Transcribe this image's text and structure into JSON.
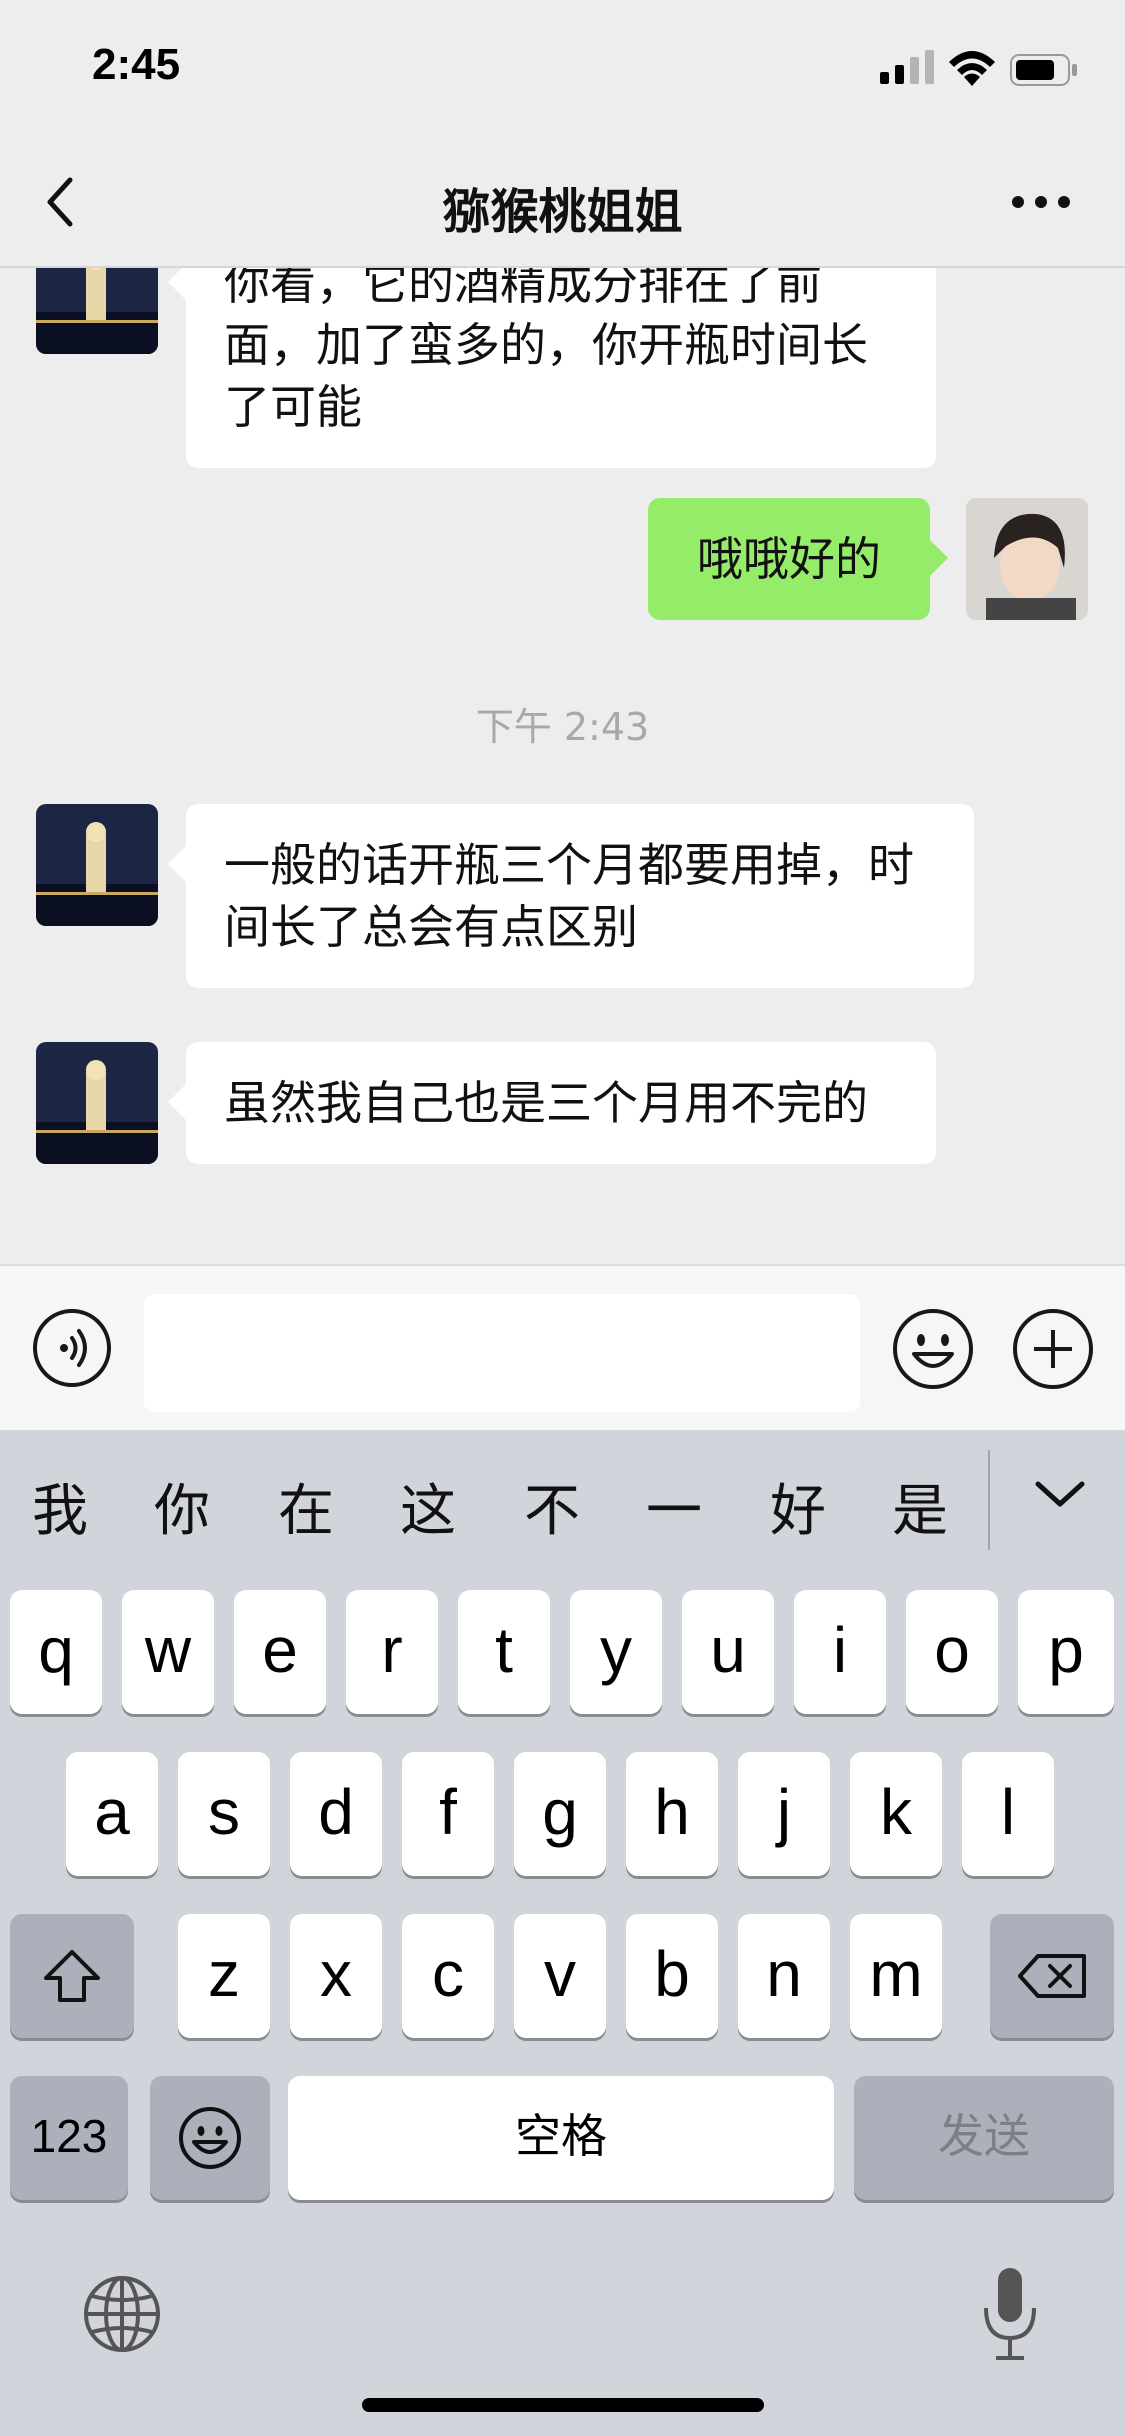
{
  "status": {
    "time": "2:45"
  },
  "nav": {
    "title": "猕猴桃姐姐"
  },
  "messages": [
    {
      "side": "left",
      "text": "你看，它的酒精成分排在了前面，加了蛮多的，你开瓶时间长了可能"
    },
    {
      "side": "right",
      "text": "哦哦好的"
    },
    {
      "type": "timestamp",
      "text": "下午 2:43"
    },
    {
      "side": "left",
      "text": "一般的话开瓶三个月都要用掉，时间长了总会有点区别"
    },
    {
      "side": "left",
      "text": "虽然我自己也是三个月用不完的"
    }
  ],
  "input": {
    "value": ""
  },
  "keyboard": {
    "candidates": [
      "我",
      "你",
      "在",
      "这",
      "不",
      "一",
      "好",
      "是"
    ],
    "row1": [
      "q",
      "w",
      "e",
      "r",
      "t",
      "y",
      "u",
      "i",
      "o",
      "p"
    ],
    "row2": [
      "a",
      "s",
      "d",
      "f",
      "g",
      "h",
      "j",
      "k",
      "l"
    ],
    "row3": [
      "z",
      "x",
      "c",
      "v",
      "b",
      "n",
      "m"
    ],
    "numbers_label": "123",
    "space_label": "空格",
    "send_label": "发送"
  },
  "colors": {
    "sent_bubble": "#95ec69",
    "received_bubble": "#ffffff",
    "background": "#ededed"
  }
}
